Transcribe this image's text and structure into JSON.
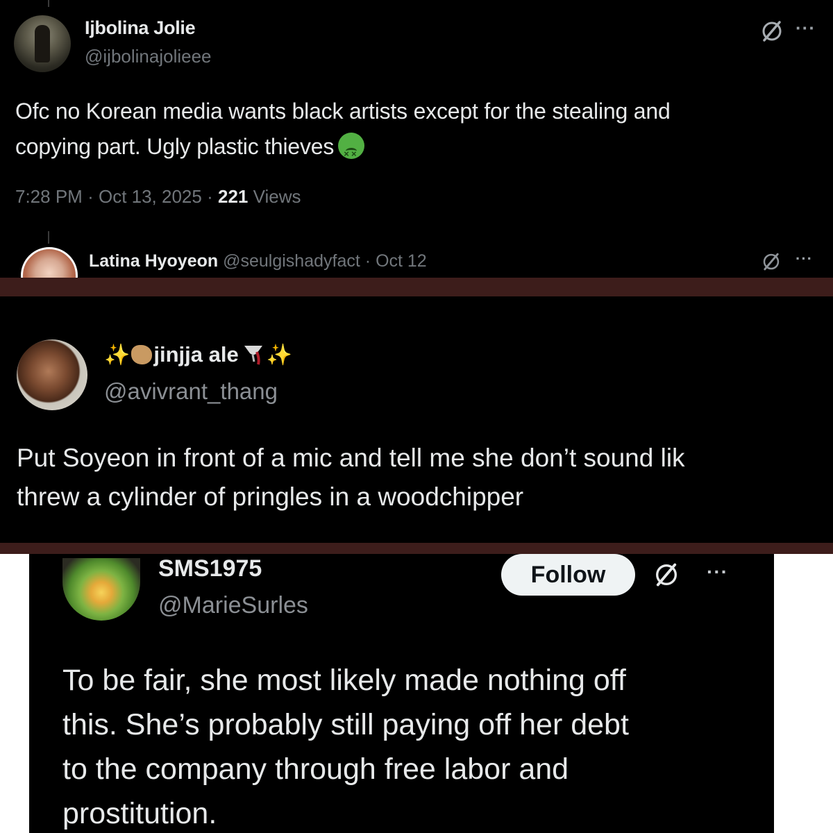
{
  "post1": {
    "author": {
      "display_name": "Ijbolina Jolie",
      "handle": "@ijbolinajolieee",
      "avatar_icon": "profile-photo"
    },
    "text_line1": "Ofc no Korean media wants black artists except for the stealing and",
    "text_line2": "copying part. Ugly plastic thieves",
    "emoji": "nauseated-face",
    "time": "7:28 PM",
    "sep1": "·",
    "date": "Oct 13, 2025",
    "sep2": "·",
    "views_count": "221",
    "views_label": "Views",
    "more_label": "···",
    "grok_icon": "grok-icon",
    "reply": {
      "display_name": "Latina Hyoyeon",
      "handle": "@seulgishadyfact",
      "sep": "·",
      "date": "Oct 12",
      "more_label": "···"
    }
  },
  "post2": {
    "author": {
      "display_name": "jinjja ale",
      "handle": "@avivrant_thang",
      "decorations": [
        "sparkles",
        "face",
        "wine-glass",
        "sparkles"
      ]
    },
    "text_line1": "Put Soyeon in front of a mic and tell me she don’t sound lik",
    "text_line2": "threw a cylinder of pringles in a woodchipper"
  },
  "post3": {
    "author": {
      "display_name": "SMS1975",
      "handle": "@MarieSurles"
    },
    "follow_label": "Follow",
    "more_label": "···",
    "text_line1": "To be fair, she most likely made nothing off",
    "text_line2": "this. She’s probably still paying off her debt",
    "text_line3": "to the company through free labor and",
    "text_line4": "prostitution."
  },
  "colors": {
    "background": "#000000",
    "text_primary": "#e7e9ea",
    "text_secondary": "#71767b",
    "separator": "#3d1d1b",
    "follow_bg": "#eff3f4"
  }
}
